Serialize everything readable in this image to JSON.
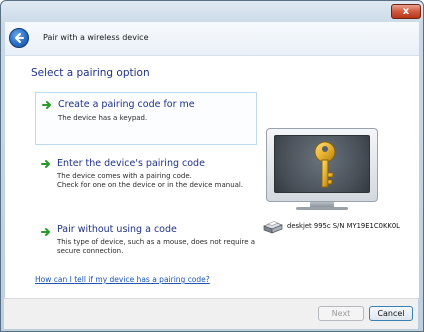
{
  "window": {
    "close_label": "x"
  },
  "header": {
    "title": "Pair with a wireless device"
  },
  "main": {
    "section_title": "Select a pairing option",
    "options": [
      {
        "title": "Create a pairing code for me",
        "description": [
          "The device has a keypad."
        ]
      },
      {
        "title": "Enter the device's pairing code",
        "description": [
          "The device comes with a pairing code.",
          "Check for one on the device or in the device manual."
        ]
      },
      {
        "title": "Pair without using a code",
        "description": [
          "This type of device, such as a mouse, does not require a",
          "secure connection."
        ]
      }
    ],
    "device_label": "deskjet 995c S/N MY19E1C0KK0L",
    "help_link": "How can I tell if my device has a pairing code?"
  },
  "footer": {
    "next_label": "Next",
    "cancel_label": "Cancel"
  },
  "icons": [
    "back-arrow-icon",
    "green-arrow-icon",
    "key-icon",
    "monitor-icon",
    "printer-icon",
    "close-icon"
  ]
}
